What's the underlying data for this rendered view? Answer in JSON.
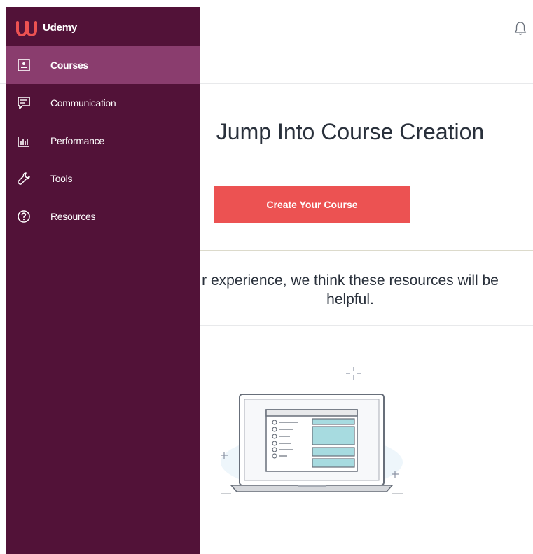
{
  "brand": {
    "name": "Udemy",
    "logo_icon": "udemy-u-logo",
    "logo_color": "#ec5252"
  },
  "sidebar": {
    "background": "#521238",
    "active_background": "#8a3d6e",
    "items": [
      {
        "label": "Courses",
        "icon": "course-slide-icon",
        "active": true
      },
      {
        "label": "Communication",
        "icon": "chat-bubble-icon",
        "active": false
      },
      {
        "label": "Performance",
        "icon": "bar-chart-icon",
        "active": false
      },
      {
        "label": "Tools",
        "icon": "wrench-icon",
        "active": false
      },
      {
        "label": "Resources",
        "icon": "question-circle-icon",
        "active": false
      }
    ]
  },
  "header": {
    "notification_icon": "bell-icon"
  },
  "main": {
    "title": "Jump Into Course Creation",
    "create_button_label": "Create Your Course",
    "button_color": "#ec5252",
    "resources_text_line1": "r experience, we think these resources will be",
    "resources_text_line2": "helpful.",
    "illustration_icon": "laptop-illustration"
  }
}
